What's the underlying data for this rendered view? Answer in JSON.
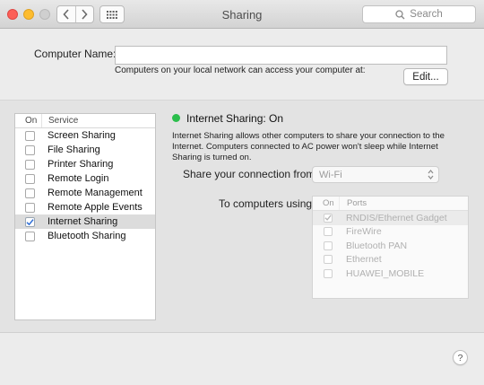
{
  "window": {
    "title": "Sharing"
  },
  "toolbar": {
    "search_placeholder": "Search"
  },
  "computer_name": {
    "label": "Computer Name:",
    "value": "",
    "hint": "Computers on your local network can access your computer at:",
    "edit_label": "Edit..."
  },
  "services": {
    "header_on": "On",
    "header_service": "Service",
    "items": [
      {
        "label": "Screen Sharing",
        "checked": false,
        "selected": false
      },
      {
        "label": "File Sharing",
        "checked": false,
        "selected": false
      },
      {
        "label": "Printer Sharing",
        "checked": false,
        "selected": false
      },
      {
        "label": "Remote Login",
        "checked": false,
        "selected": false
      },
      {
        "label": "Remote Management",
        "checked": false,
        "selected": false
      },
      {
        "label": "Remote Apple Events",
        "checked": false,
        "selected": false
      },
      {
        "label": "Internet Sharing",
        "checked": true,
        "selected": true
      },
      {
        "label": "Bluetooth Sharing",
        "checked": false,
        "selected": false
      }
    ]
  },
  "detail": {
    "status_title": "Internet Sharing: On",
    "status_color": "#2bbe4c",
    "description": "Internet Sharing allows other computers to share your connection to the Internet. Computers connected to AC power won't sleep while Internet Sharing is turned on.",
    "share_from_label": "Share your connection from:",
    "share_from_value": "Wi-Fi",
    "to_computers_label": "To computers using:",
    "ports_header_on": "On",
    "ports_header_ports": "Ports",
    "ports": [
      {
        "label": "RNDIS/Ethernet Gadget",
        "checked": true,
        "selected": true
      },
      {
        "label": "FireWire",
        "checked": false,
        "selected": false
      },
      {
        "label": "Bluetooth PAN",
        "checked": false,
        "selected": false
      },
      {
        "label": "Ethernet",
        "checked": false,
        "selected": false
      },
      {
        "label": "HUAWEI_MOBILE",
        "checked": false,
        "selected": false
      }
    ]
  },
  "help": {
    "label": "?"
  }
}
